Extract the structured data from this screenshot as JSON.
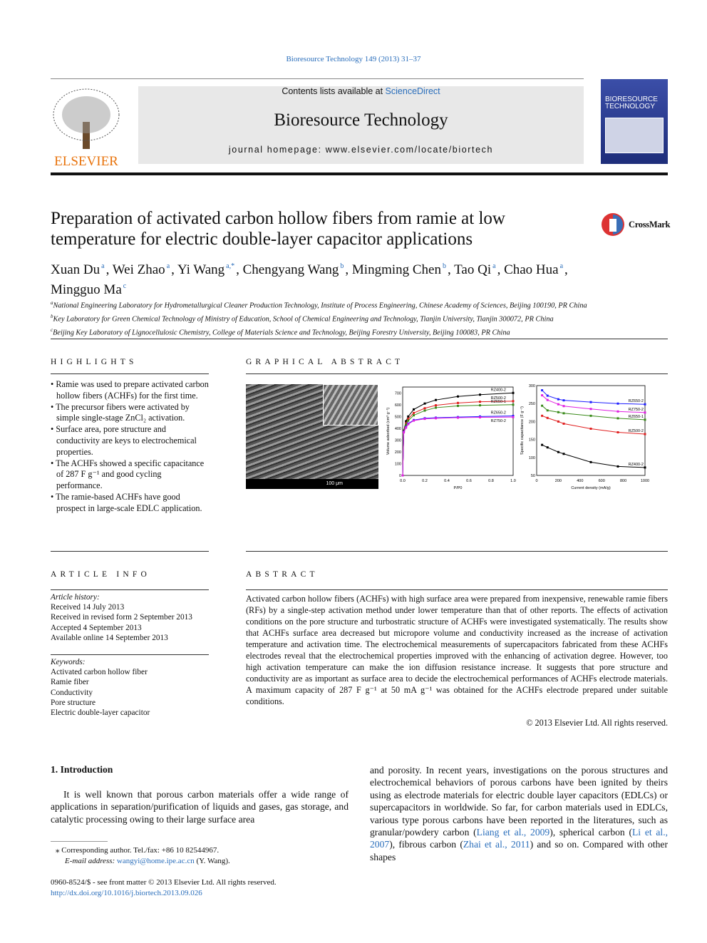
{
  "journal_ref": "Bioresource Technology 149 (2013) 31–37",
  "header": {
    "publisher": "ELSEVIER",
    "contents_prefix": "Contents lists available at ",
    "contents_link": "ScienceDirect",
    "journal": "Bioresource Technology",
    "homepage": "journal homepage: www.elsevier.com/locate/biortech",
    "cover_title": "BIORESOURCE TECHNOLOGY"
  },
  "crossmark": "CrossMark",
  "title": "Preparation of activated carbon hollow fibers from ramie at low temperature for electric double-layer capacitor applications",
  "authors": [
    {
      "name": "Xuan Du",
      "sup": "a"
    },
    {
      "name": "Wei Zhao",
      "sup": "a"
    },
    {
      "name": "Yi Wang",
      "sup": "a,*"
    },
    {
      "name": "Chengyang Wang",
      "sup": "b"
    },
    {
      "name": "Mingming Chen",
      "sup": "b"
    },
    {
      "name": "Tao Qi",
      "sup": "a"
    },
    {
      "name": "Chao Hua",
      "sup": "a"
    },
    {
      "name": "Mingguo Ma",
      "sup": "c"
    }
  ],
  "affiliations": [
    {
      "sup": "a",
      "text": "National Engineering Laboratory for Hydrometallurgical Cleaner Production Technology, Institute of Process Engineering, Chinese Academy of Sciences, Beijing 100190, PR China"
    },
    {
      "sup": "b",
      "text": "Key Laboratory for Green Chemical Technology of Ministry of Education, School of Chemical Engineering and Technology, Tianjin University, Tianjin 300072, PR China"
    },
    {
      "sup": "c",
      "text": "Beijing Key Laboratory of Lignocellulosic Chemistry, College of Materials Science and Technology, Beijing Forestry University, Beijing 100083, PR China"
    }
  ],
  "highlights": {
    "heading": "HIGHLIGHTS",
    "items": [
      "Ramie was used to prepare activated carbon hollow fibers (ACHFs) for the first time.",
      "The precursor fibers were activated by simple single-stage ZnCl₂ activation.",
      "Surface area, pore structure and conductivity are keys to electrochemical properties.",
      "The ACHFs showed a specific capacitance of 287 F g⁻¹ and good cycling performance.",
      "The ramie-based ACHFs have good prospect in large-scale EDLC application."
    ]
  },
  "graphical_abstract": {
    "heading": "GRAPHICAL ABSTRACT",
    "sem_label": "100 μm",
    "chart_data": [
      {
        "type": "line",
        "xlabel": "P/P0",
        "ylabel": "Volume adsorbed (cm³ g⁻¹)",
        "xlim": [
          0,
          1.0
        ],
        "ylim": [
          0,
          750
        ],
        "xticks": [
          "0.0",
          "0.2",
          "0.4",
          "0.6",
          "0.8",
          "1.0"
        ],
        "yticks": [
          "0",
          "100",
          "200",
          "300",
          "400",
          "500",
          "600",
          "700"
        ],
        "x": [
          0,
          0.01,
          0.03,
          0.05,
          0.1,
          0.2,
          0.3,
          0.5,
          0.7,
          1.0
        ],
        "series": [
          {
            "name": "RZ400-2",
            "color": "#000000",
            "values": [
              0,
              380,
              460,
              500,
              560,
              610,
              640,
              670,
              685,
              700
            ]
          },
          {
            "name": "RZ500-2",
            "color": "#e02020",
            "values": [
              0,
              375,
              440,
              480,
              530,
              570,
              595,
              615,
              625,
              630
            ]
          },
          {
            "name": "RZ650-1",
            "color": "#3a8a1a",
            "values": [
              0,
              370,
              430,
              465,
              510,
              550,
              575,
              590,
              595,
              600
            ]
          },
          {
            "name": "RZ650-2",
            "color": "#2020ff",
            "values": [
              0,
              370,
              410,
              440,
              470,
              485,
              490,
              495,
              500,
              505
            ]
          },
          {
            "name": "RZ750-2",
            "color": "#e020e0",
            "values": [
              0,
              365,
              405,
              435,
              465,
              480,
              485,
              490,
              493,
              495
            ]
          }
        ]
      },
      {
        "type": "line",
        "xlabel": "Current density (mA/g)",
        "ylabel": "Specific capacitance (F g⁻¹)",
        "xlim": [
          0,
          1000
        ],
        "ylim": [
          50,
          300
        ],
        "xticks": [
          "0",
          "200",
          "400",
          "600",
          "800",
          "1000"
        ],
        "yticks": [
          "50",
          "100",
          "150",
          "200",
          "250",
          "300"
        ],
        "x": [
          50,
          100,
          200,
          250,
          500,
          750,
          1000
        ],
        "series": [
          {
            "name": "RZ650-2",
            "color": "#2020ff",
            "values": [
              287,
              272,
              262,
              259,
              254,
              250,
              248
            ]
          },
          {
            "name": "RZ750-2",
            "color": "#e020e0",
            "values": [
              273,
              260,
              248,
              243,
              235,
              228,
              225
            ]
          },
          {
            "name": "RZ650-1",
            "color": "#3a8a1a",
            "values": [
              244,
              231,
              226,
              223,
              216,
              209,
              205
            ]
          },
          {
            "name": "RZ500-2",
            "color": "#e02020",
            "values": [
              216,
              210,
              200,
              194,
              180,
              170,
              165
            ]
          },
          {
            "name": "RZ400-2",
            "color": "#000000",
            "values": [
              135,
              128,
              115,
              110,
              87,
              75,
              72
            ]
          }
        ]
      }
    ]
  },
  "article_info": {
    "heading": "ARTICLE INFO",
    "history_label": "Article history:",
    "history": [
      "Received 14 July 2013",
      "Received in revised form 2 September 2013",
      "Accepted 4 September 2013",
      "Available online 14 September 2013"
    ],
    "keywords_label": "Keywords:",
    "keywords": [
      "Activated carbon hollow fiber",
      "Ramie fiber",
      "Conductivity",
      "Pore structure",
      "Electric double-layer capacitor"
    ]
  },
  "abstract": {
    "heading": "ABSTRACT",
    "text": "Activated carbon hollow fibers (ACHFs) with high surface area were prepared from inexpensive, renewable ramie fibers (RFs) by a single-step activation method under lower temperature than that of other reports. The effects of activation conditions on the pore structure and turbostratic structure of ACHFs were investigated systematically. The results show that ACHFs surface area decreased but micropore volume and conductivity increased as the increase of activation temperature and activation time. The electrochemical measurements of supercapacitors fabricated from these ACHFs electrodes reveal that the electrochemical properties improved with the enhancing of activation degree. However, too high activation temperature can make the ion diffusion resistance increase. It suggests that pore structure and conductivity are as important as surface area to decide the electrochemical performances of ACHFs electrode materials. A maximum capacity of 287 F g⁻¹ at 50 mA g⁻¹ was obtained for the ACHFs electrode prepared under suitable conditions.",
    "copyright": "© 2013 Elsevier Ltd. All rights reserved."
  },
  "intro": {
    "heading": "1. Introduction",
    "left": "It is well known that porous carbon materials offer a wide range of applications in separation/purification of liquids and gases, gas storage, and catalytic processing owing to their large surface area",
    "right_parts": [
      "and porosity. In recent years, investigations on the porous structures and electrochemical behaviors of porous carbons have been ignited by theirs using as electrode materials for electric double layer capacitors (EDLCs) or supercapacitors in worldwide. So far, for carbon materials used in EDLCs, various type porous carbons have been reported in the literatures, such as granular/powdery carbon (",
      "Liang et al., 2009",
      "), spherical carbon (",
      "Li et al., 2007",
      "), fibrous carbon (",
      "Zhai et al., 2011",
      ") and so on. Compared with other shapes"
    ]
  },
  "footnote": {
    "corresponding": "Corresponding author. Tel./fax: +86 10 82544967.",
    "email_label": "E-mail address:",
    "email": "wangyi@home.ipe.ac.cn",
    "email_suffix": " (Y. Wang)."
  },
  "bottom": {
    "issn": "0960-8524/$ - see front matter © 2013 Elsevier Ltd. All rights reserved.",
    "doi": "http://dx.doi.org/10.1016/j.biortech.2013.09.026"
  }
}
